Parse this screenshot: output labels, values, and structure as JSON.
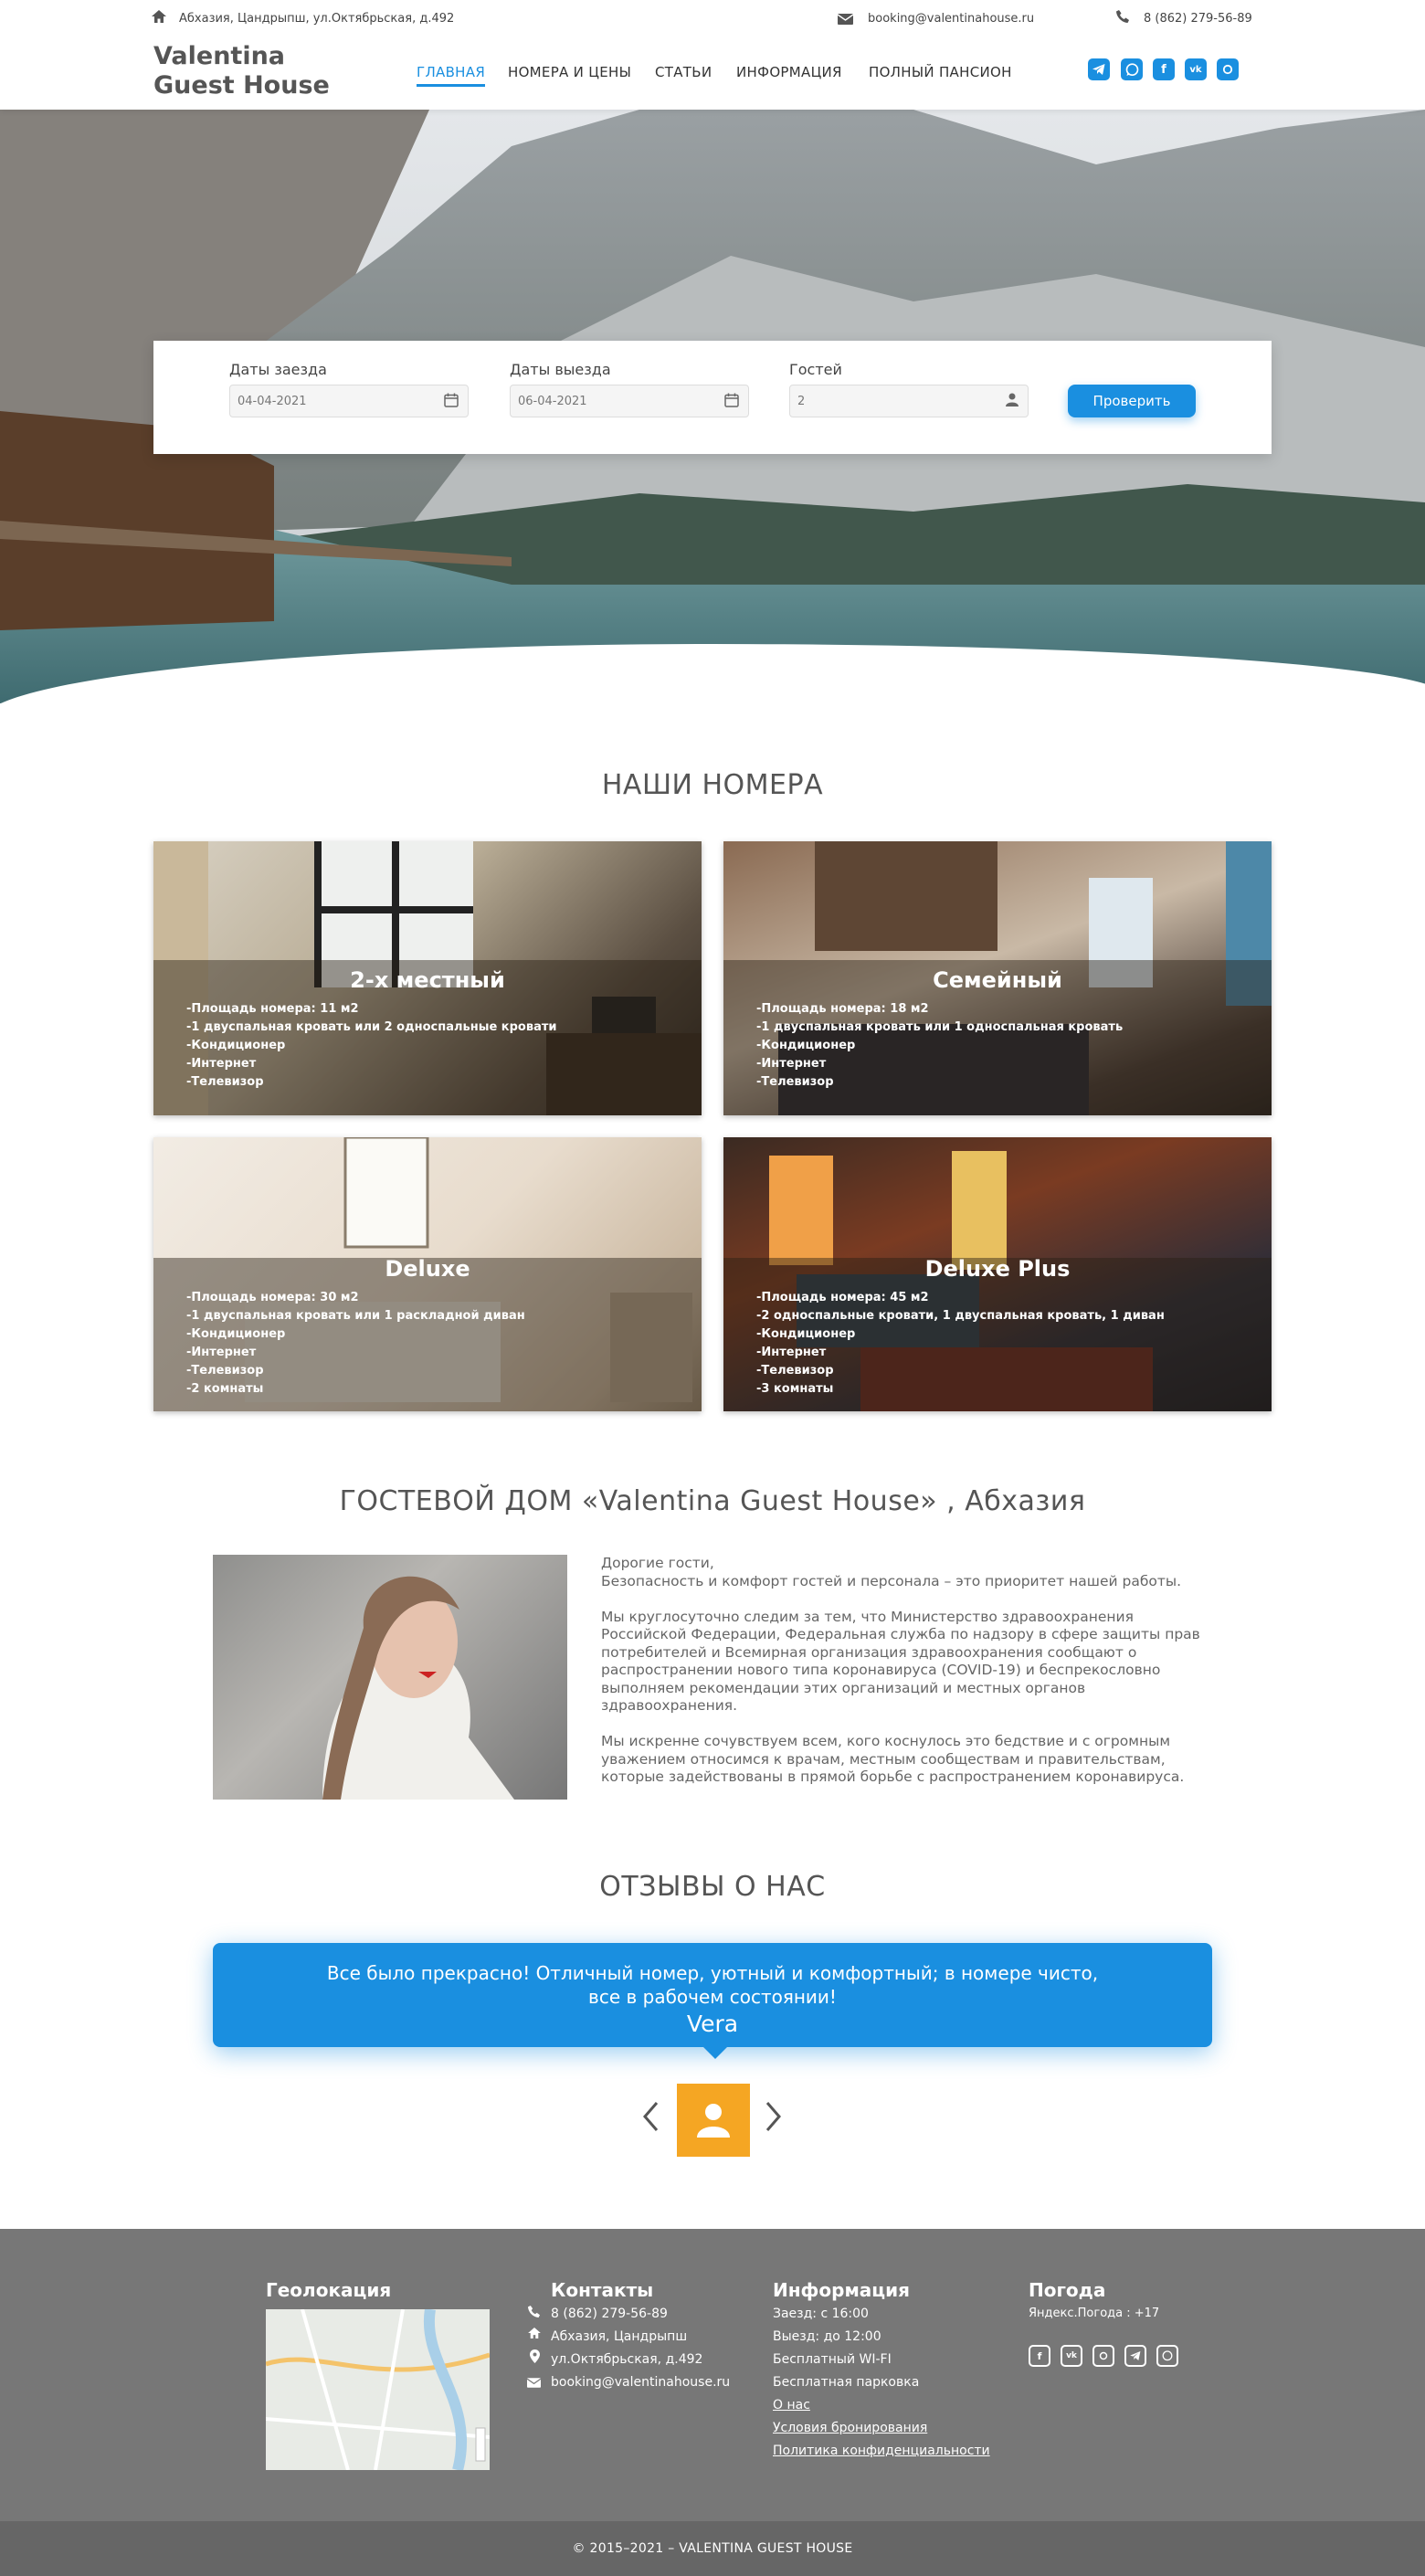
{
  "header": {
    "address": "Абхазия, Цандрыпш, ул.Октябрьская, д.492",
    "email": "booking@valentinahouse.ru",
    "phone": "8 (862) 279-56-89",
    "logo_line1": "Valentina",
    "logo_line2": "Guest House",
    "nav": [
      "ГЛАВНАЯ",
      "НОМЕРА И ЦЕНЫ",
      "СТАТЬИ",
      "ИНФОРМАЦИЯ",
      "ПОЛНЫЙ ПАНСИОН"
    ],
    "social_icons": [
      "telegram-icon",
      "whatsapp-icon",
      "facebook-icon",
      "vk-icon",
      "odnoklassniki-icon"
    ]
  },
  "booking": {
    "checkin_label": "Даты заезда",
    "checkin_value": "04-04-2021",
    "checkout_label": "Даты выезда",
    "checkout_value": "06-04-2021",
    "guests_label": "Гостей",
    "guests_value": "2",
    "button": "Проверить"
  },
  "rooms_title": "НАШИ НОМЕРА",
  "rooms": [
    {
      "name": "2-х местный",
      "features": [
        "-Площадь номера: 11 м2",
        "-1 двуспальная кровать или 2 односпальные кровати",
        "-Кондиционер",
        "-Интернет",
        "-Телевизор"
      ]
    },
    {
      "name": "Семейный",
      "features": [
        "-Площадь номера: 18 м2",
        "-1 двуспальная кровать или 1 односпальная кровать",
        "-Кондиционер",
        "-Интернет",
        "-Телевизор"
      ]
    },
    {
      "name": "Deluxe",
      "features": [
        "-Площадь номера: 30 м2",
        "-1 двуспальная кровать или 1 раскладной диван",
        "-Кондиционер",
        "-Интернет",
        "-Телевизор",
        "-2 комнаты"
      ]
    },
    {
      "name": "Deluxe Plus",
      "features": [
        "-Площадь номера: 45 м2",
        "-2 односпальные кровати, 1 двуспальная кровать, 1 диван",
        "-Кондиционер",
        "-Интернет",
        "-Телевизор",
        "-3 комнаты"
      ]
    }
  ],
  "about": {
    "title": "ГОСТЕВОЙ ДОМ «Valentina Guest House» , Абхазия",
    "p1a": "Дорогие гости,",
    "p1b": "Безопасность и комфорт гостей и персонала – это приоритет нашей работы.",
    "p2": "Мы круглосуточно следим за тем, что Министерство здравоохранения Российской Федерации, Федеральная служба по надзору в сфере защиты прав потребителей и Всемирная организация здравоохранения сообщают о распространении нового типа коронавируса (COVID-19) и беспрекословно выполняем рекомендации этих организаций и местных органов здравоохранения.",
    "p3": "Мы искренне сочувствуем всем, кого коснулось это бедствие и с огромным уважением относимся к врачам, местным сообществам и правительствам, которые задействованы в прямой борьбе с распространением коронавируса."
  },
  "reviews": {
    "title": "ОТЗЫВЫ О НАС",
    "text": "Все было прекрасно! Отличный номер, уютный и комфортный; в номере чисто, все в рабочем состоянии!",
    "author": "Vera"
  },
  "footer": {
    "geo_title": "Геолокация",
    "contacts_title": "Контакты",
    "contacts": [
      "8 (862) 279-56-89",
      "Абхазия, Цандрыпш",
      "ул.Октябрьская, д.492",
      "booking@valentinahouse.ru"
    ],
    "info_title": "Информация",
    "info": [
      "Заезд: с 16:00",
      "Выезд: до 12:00",
      "Бесплатный WI-FI",
      "Бесплатная парковка"
    ],
    "info_links": [
      "О нас",
      "Условия бронирования",
      "Политика конфиденциальности"
    ],
    "weather_title": "Погода",
    "weather": "Яндекс.Погода : +17",
    "copyright": "© 2015–2021 – VALENTINA GUEST HOUSE"
  },
  "colors": {
    "accent": "#1a8fe0",
    "footer": "#777777",
    "avatar": "#f5a623"
  }
}
